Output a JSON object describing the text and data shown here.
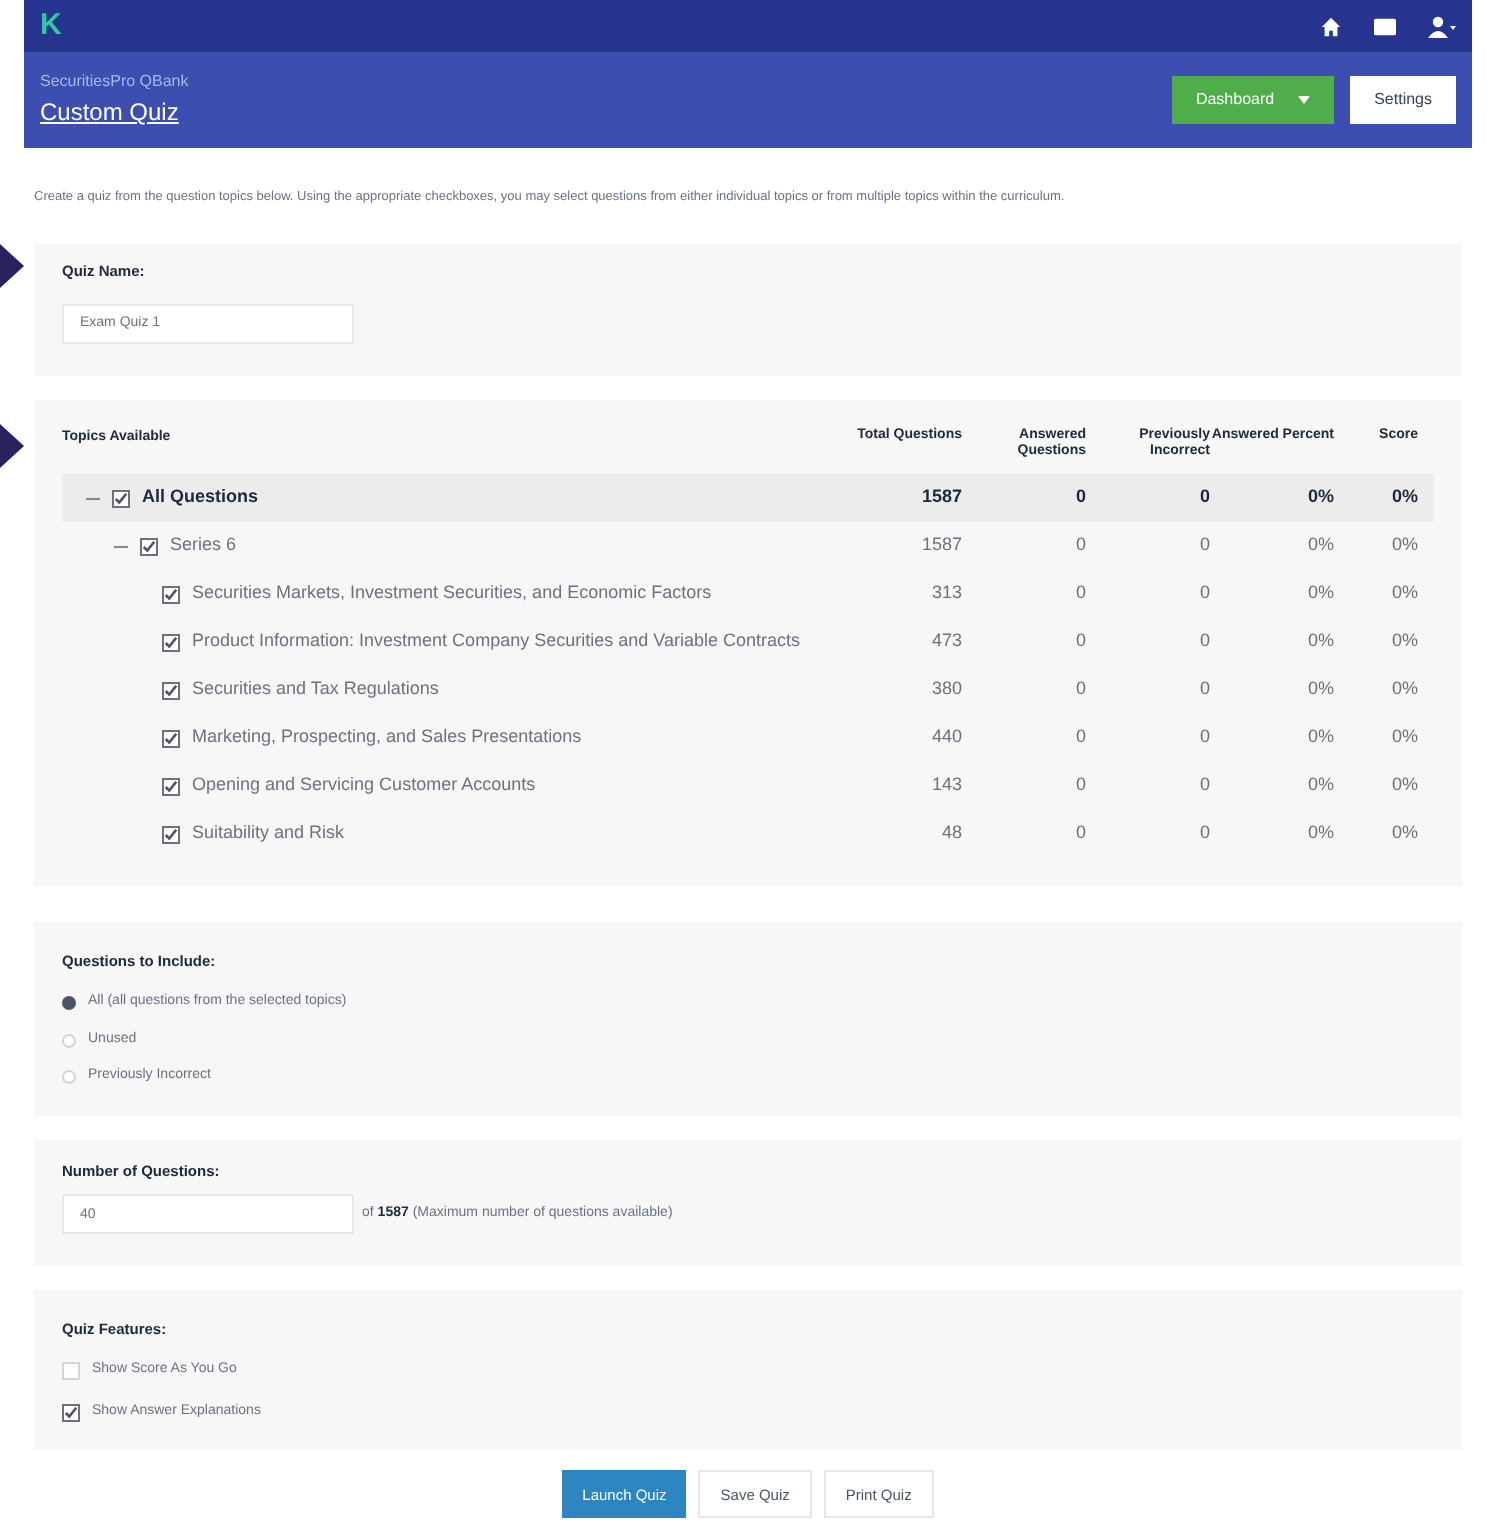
{
  "app_bar": {
    "logo": "K"
  },
  "header": {
    "subtitle": "SecuritiesPro QBank",
    "title": "Custom Quiz",
    "dashboard_button": "Dashboard",
    "settings_button": "Settings"
  },
  "description": "Create a quiz from the question topics below. Using the appropriate checkboxes, you may select questions from either individual topics or from multiple topics within the curriculum.",
  "quiz_name": {
    "label": "Quiz Name:",
    "value": "Exam Quiz 1"
  },
  "topics": {
    "columns": [
      "Topics Available",
      "Total Questions",
      "Answered Questions",
      "Previously Incorrect",
      "Answered Percent",
      "Score"
    ],
    "rows": [
      {
        "name": "All Questions",
        "checked": true,
        "expanded": true,
        "values": [
          "1587",
          "0",
          "0",
          "0%",
          "0%"
        ],
        "children": [
          {
            "name": "Series 6",
            "checked": true,
            "expanded": true,
            "values": [
              "1587",
              "0",
              "0",
              "0%",
              "0%"
            ],
            "children": [
              {
                "name": "Securities Markets, Investment Securities, and Economic Factors",
                "checked": true,
                "values": [
                  "313",
                  "0",
                  "0",
                  "0%",
                  "0%"
                ]
              },
              {
                "name": "Product Information: Investment Company Securities and Variable Contracts",
                "checked": true,
                "values": [
                  "473",
                  "0",
                  "0",
                  "0%",
                  "0%"
                ]
              },
              {
                "name": "Securities and Tax Regulations",
                "checked": true,
                "values": [
                  "380",
                  "0",
                  "0",
                  "0%",
                  "0%"
                ]
              },
              {
                "name": "Marketing, Prospecting, and Sales Presentations",
                "checked": true,
                "values": [
                  "440",
                  "0",
                  "0",
                  "0%",
                  "0%"
                ]
              },
              {
                "name": "Opening and Servicing Customer Accounts",
                "checked": true,
                "values": [
                  "143",
                  "0",
                  "0",
                  "0%",
                  "0%"
                ]
              },
              {
                "name": "Suitability and Risk",
                "checked": true,
                "values": [
                  "48",
                  "0",
                  "0",
                  "0%",
                  "0%"
                ]
              }
            ]
          }
        ]
      }
    ]
  },
  "include": {
    "label": "Questions to Include:",
    "options": [
      {
        "label": "All (all questions from the selected topics)",
        "selected": true
      },
      {
        "label": "Unused",
        "selected": false
      },
      {
        "label": "Previously Incorrect",
        "selected": false
      }
    ]
  },
  "number": {
    "label": "Number of Questions:",
    "value": "40",
    "prefix": "of",
    "max": "1587",
    "suffix": "(Maximum number of questions available)"
  },
  "features": {
    "label": "Quiz Features:",
    "options": [
      {
        "label": "Show Score As You Go",
        "checked": false
      },
      {
        "label": "Show Answer Explanations",
        "checked": true
      }
    ]
  },
  "buttons": [
    "Launch Quiz",
    "Save Quiz",
    "Print Quiz"
  ]
}
